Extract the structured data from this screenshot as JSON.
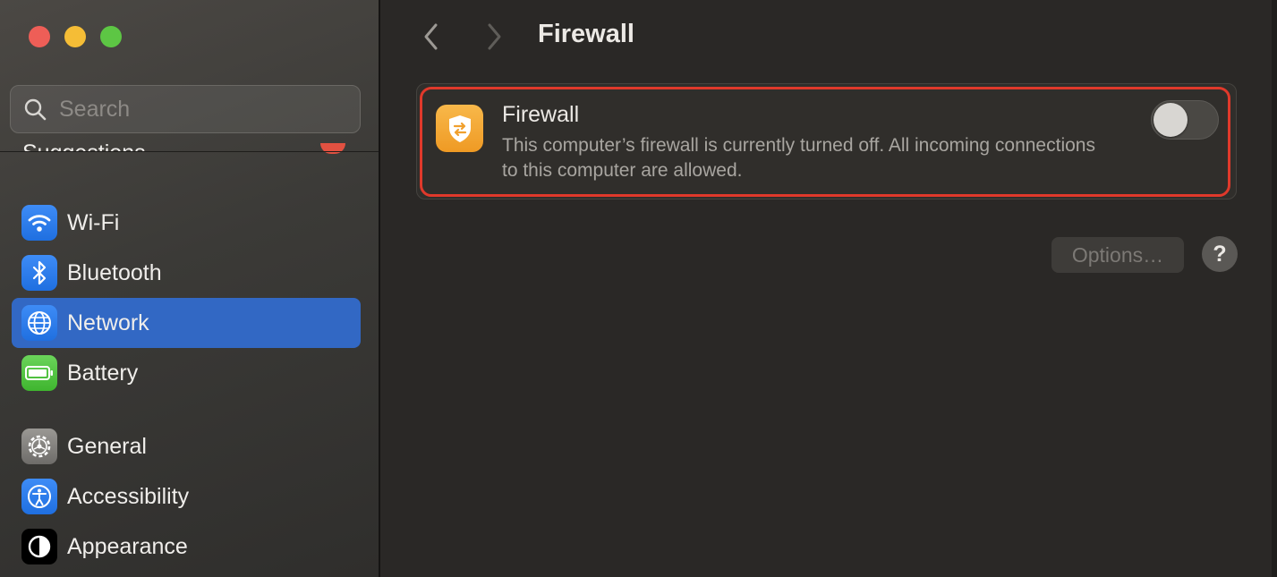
{
  "window": {
    "title": "Firewall",
    "traffic_lights": [
      "close",
      "minimize",
      "zoom"
    ]
  },
  "sidebar": {
    "search_placeholder": "Search",
    "section_label": "Suggestions",
    "items": [
      {
        "label": "Wi-Fi",
        "icon": "wifi-icon",
        "selected": false
      },
      {
        "label": "Bluetooth",
        "icon": "bluetooth-icon",
        "selected": false
      },
      {
        "label": "Network",
        "icon": "globe-icon",
        "selected": true
      },
      {
        "label": "Battery",
        "icon": "battery-icon",
        "selected": false
      },
      {
        "label": "General",
        "icon": "gear-icon",
        "selected": false
      },
      {
        "label": "Accessibility",
        "icon": "accessibility-icon",
        "selected": false
      },
      {
        "label": "Appearance",
        "icon": "appearance-icon",
        "selected": false
      }
    ]
  },
  "main": {
    "page_title": "Firewall",
    "firewall": {
      "title": "Firewall",
      "description": "This computer’s firewall is currently turned off. All incoming connections to this computer are allowed.",
      "enabled": false
    },
    "options_label": "Options…",
    "help_label": "?"
  },
  "colors": {
    "selection": "#3268c4",
    "highlight_border": "#e0392b",
    "firewall_icon": "#f3a535"
  }
}
